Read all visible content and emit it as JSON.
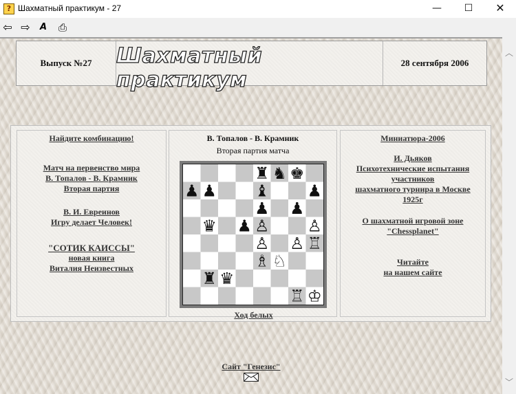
{
  "window": {
    "title": "Шахматный практикум - 27",
    "icon": "help-book-icon",
    "controls": {
      "minimize": "—",
      "maximize": "☐",
      "close": "✕"
    }
  },
  "toolbar": {
    "back_icon": "⇦",
    "forward_icon": "⇨",
    "font_icon": "A",
    "print_icon": "⎙"
  },
  "header": {
    "issue": "Выпуск №27",
    "logo": "Шахматный практикум",
    "date": "28 сентября 2006"
  },
  "left_column": {
    "find_combination": "Найдите комбинацию!",
    "match_line1": "Матч на первенство мира",
    "match_line2": "В. Топалов - В. Крамник",
    "match_line3": "Вторая партия",
    "evreinov_line1": "В. И. Евреинов",
    "evreinov_line2": "Игру делает Человек!",
    "book_line1": "\"СОТИК КАИССЫ\"",
    "book_line2": "новая книга",
    "book_line3": "Виталия Неизвестных"
  },
  "middle_column": {
    "players": "В. Топалов - В. Крамник",
    "game": "Вторая партия матча",
    "to_move": "Ход белых",
    "board": {
      "rows": [
        "....rnk.",
        "pp..b..p",
        "....p.p.",
        ".q.pP..P",
        "....P.PR",
        "....BN..",
        ".rq.....",
        "......RK"
      ],
      "light_color": "#ffffff",
      "dark_color": "#c8c8c8"
    }
  },
  "right_column": {
    "miniature": "Миниатюра-2006",
    "dyakov_author": "И. Дьяков",
    "dyakov_line1": "Психотехнические испытания",
    "dyakov_line2": "участников",
    "dyakov_line3": "шахматного турнира в Москве",
    "dyakov_line4": "1925г",
    "chessplanet_line1": "О шахматной игровой зоне",
    "chessplanet_line2": "\"Chessplanet\"",
    "read_line1": "Читайте",
    "read_line2": "на нашем сайте"
  },
  "footer": {
    "site_link": "Сайт \"Генезис\"",
    "mail_icon": "envelope-icon"
  },
  "scrollbar": {
    "up": "︿",
    "down": "﹀"
  }
}
